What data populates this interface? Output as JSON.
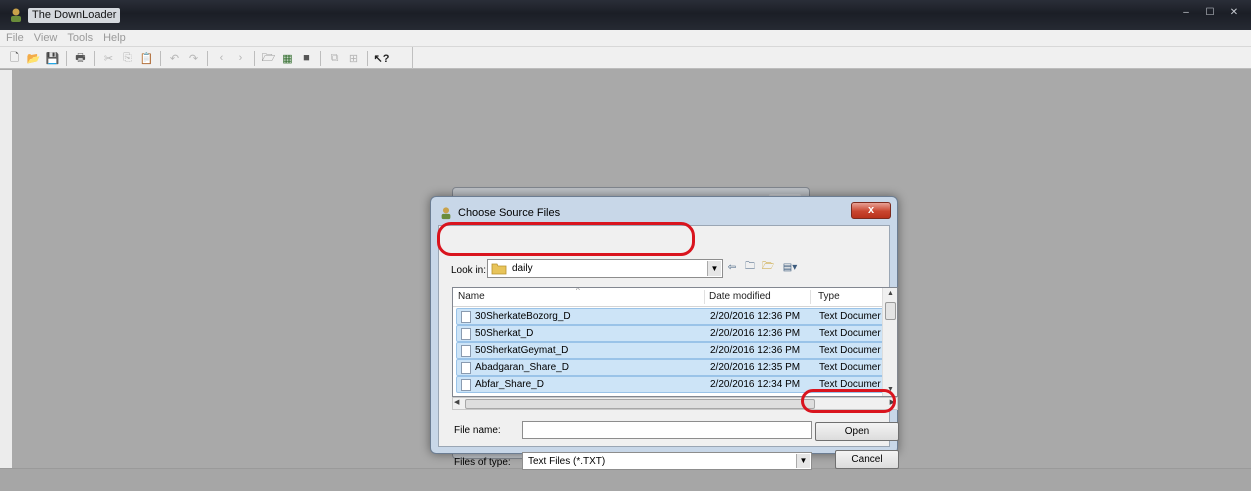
{
  "app": {
    "title": "The DownLoader",
    "window_buttons": [
      "–",
      "☐",
      "✕"
    ]
  },
  "menubar": [
    "File",
    "View",
    "Tools",
    "Help"
  ],
  "toolbar": {
    "groups": [
      [
        "new-icon",
        "open-icon",
        "save-icon"
      ],
      [
        "print-icon"
      ],
      [
        "cut-icon",
        "copy-icon",
        "paste-icon"
      ],
      [
        "undo-icon",
        "redo-icon"
      ],
      [
        "back-icon",
        "forward-icon"
      ],
      [
        "folder-open-icon",
        "download-icon",
        "stop-icon"
      ],
      [
        "copy-grid-icon",
        "grid-icon"
      ],
      [
        "help-pointer-icon"
      ]
    ]
  },
  "dialog": {
    "title": "Choose Source Files",
    "close_label": "x",
    "look_in_label": "Look in:",
    "look_in_value": "daily",
    "columns": [
      "Name",
      "Date modified",
      "Type"
    ],
    "files": [
      {
        "name": "30SherkateBozorg_D",
        "date": "2/20/2016 12:36 PM",
        "type": "Text Documer"
      },
      {
        "name": "50Sherkat_D",
        "date": "2/20/2016 12:36 PM",
        "type": "Text Documer"
      },
      {
        "name": "50SherkatGeymat_D",
        "date": "2/20/2016 12:36 PM",
        "type": "Text Documer"
      },
      {
        "name": "Abadgaran_Share_D",
        "date": "2/20/2016 12:35 PM",
        "type": "Text Documer"
      },
      {
        "name": "Abfar_Share_D",
        "date": "2/20/2016 12:34 PM",
        "type": "Text Documer"
      }
    ],
    "file_name_label": "File name:",
    "file_name_value": "",
    "files_of_type_label": "Files of type:",
    "files_of_type_value": "Text Files (*.TXT)",
    "open_label": "Open",
    "cancel_label": "Cancel"
  },
  "colors": {
    "highlight": "#d9141e",
    "selection": "#cde4f7",
    "workspace": "#a9a9a9"
  }
}
